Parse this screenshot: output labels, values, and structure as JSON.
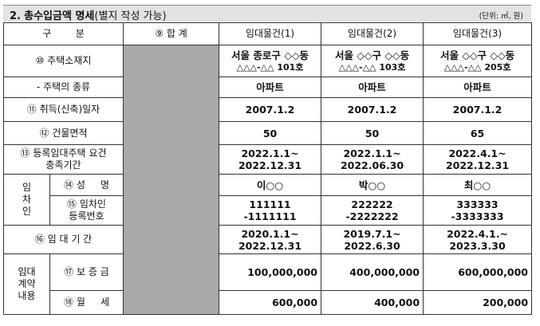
{
  "header": {
    "title_number": "2.",
    "title_bold": "총수입금액 명세",
    "title_plain": "(별지 작성 가능)",
    "unit": "(단위: ㎡, 원)"
  },
  "columns": {
    "category": "구        분",
    "total": "⑨ 합     계",
    "house1": "임대물건(1)",
    "house2": "임대물건(2)",
    "house3": "임대물건(3)"
  },
  "rows": {
    "address": {
      "label": "⑩ 주택소재지",
      "values": [
        [
          "서울 종로구 ◇◇동",
          "△△△-△△ 101호"
        ],
        [
          "서울 ◇◇구 ◇◇동",
          "△△△-△△ 103호"
        ],
        [
          "서울 ◇◇구 ◇◇동",
          "△△△-△△ 205호"
        ]
      ]
    },
    "house_type": {
      "label": "- 주택의 종류",
      "values": [
        "아파트",
        "아파트",
        "아파트"
      ]
    },
    "acquisition_date": {
      "label": "⑪ 취득(신축)일자",
      "values": [
        "2007.1.2",
        "2007.1.2",
        "2007.1.2"
      ]
    },
    "area": {
      "label": "⑫ 건물면적",
      "values": [
        "50",
        "50",
        "65"
      ]
    },
    "registration_period": {
      "label_line1": "⑬ 등록임대주택 요건",
      "label_line2": "충족기간",
      "values": [
        [
          "2022.1.1~",
          "2022.12.31"
        ],
        [
          "2022.1.1~",
          "2022.06.30"
        ],
        [
          "2022.4.1~",
          "2022.12.31"
        ]
      ]
    },
    "tenant": {
      "group_label": [
        "임",
        "차",
        "인"
      ],
      "name_label": "⑭ 성     명",
      "names": [
        "이○○",
        "박○○",
        "최○○"
      ],
      "regno_label_line1": "⑮ 임차인",
      "regno_label_line2": "등록번호",
      "regnos": [
        [
          "111111",
          "-1111111"
        ],
        [
          "222222",
          "-2222222"
        ],
        [
          "333333",
          "-3333333"
        ]
      ]
    },
    "lease_period": {
      "label": "⑯ 임 대 기 간",
      "values": [
        [
          "2020.1.1~",
          "2022.12.31"
        ],
        [
          "2019.7.1~",
          "2022.6.30"
        ],
        [
          "2022.4.1.~",
          "2023.3.30"
        ]
      ]
    },
    "contract": {
      "group_label": [
        "임대",
        "계약",
        "내용"
      ],
      "deposit_label": "⑰ 보 증 금",
      "deposits": [
        "100,000,000",
        "400,000,000",
        "600,000,000"
      ],
      "rent_label": "⑱ 월     세",
      "rents": [
        "600,000",
        "400,000",
        "200,000"
      ]
    }
  }
}
